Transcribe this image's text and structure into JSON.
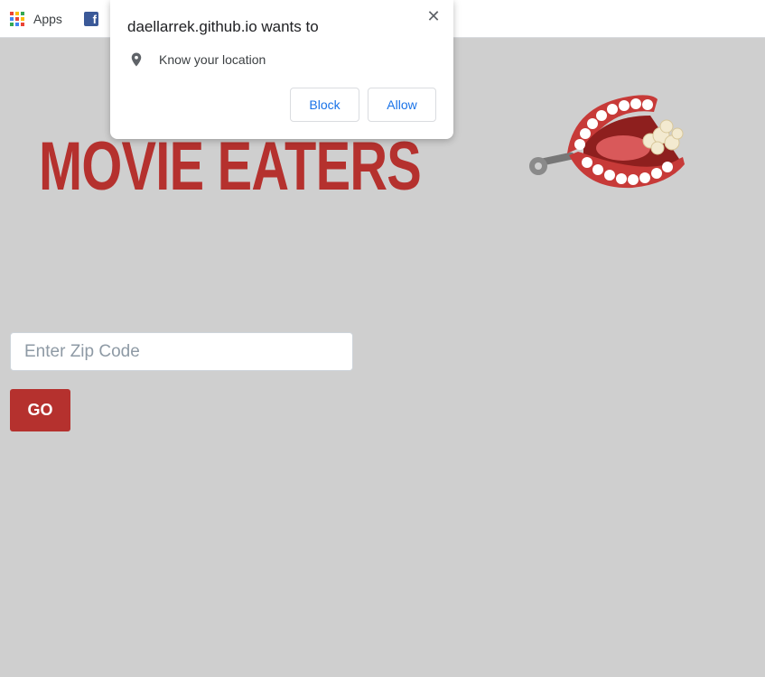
{
  "bookmarks": {
    "apps_label": "Apps",
    "apps_icon": "apps-grid-icon",
    "facebook_icon": "facebook-icon",
    "facebook_glyph": "f"
  },
  "page": {
    "title": "MOVIE EATERS",
    "brand_color": "#b5312e",
    "background": "#cfcfcf"
  },
  "search": {
    "placeholder": "Enter Zip Code",
    "value": "",
    "go_label": "GO"
  },
  "permission": {
    "title": "daellarrek.github.io wants to",
    "request_text": "Know your location",
    "block_label": "Block",
    "allow_label": "Allow",
    "close_glyph": "✕"
  }
}
